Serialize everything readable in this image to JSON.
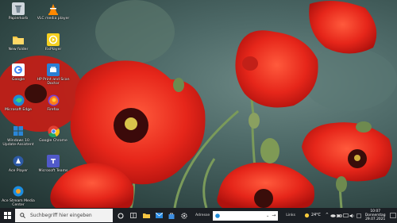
{
  "desktop": {
    "icons": [
      {
        "label": "Papierkorb"
      },
      {
        "label": "VLC media player"
      },
      {
        "label": "New folder"
      },
      {
        "label": "FixPlayer"
      },
      {
        "label": "Google"
      },
      {
        "label": "HP Print and Scan Doctor"
      },
      {
        "label": "Microsoft Edge"
      },
      {
        "label": "Firefox"
      },
      {
        "label": "Windows 10 Update-Assistent"
      },
      {
        "label": "Google Chrome"
      },
      {
        "label": "Ace Player"
      },
      {
        "label": "Microsoft Teams"
      },
      {
        "label": "Ace Stream Media Center"
      }
    ]
  },
  "taskbar": {
    "search_placeholder": "Suchbegriff hier eingeben",
    "address_label": "Adresse",
    "address_value": "",
    "links_label": "Links",
    "weather": "24°C",
    "clock_time": "10:07",
    "clock_day": "Donnerstag",
    "clock_date": "29.07.2021",
    "notification_count": "2"
  },
  "colors": {
    "taskbar_bg": "#1b1f24",
    "poppy_red": "#e8281c"
  }
}
